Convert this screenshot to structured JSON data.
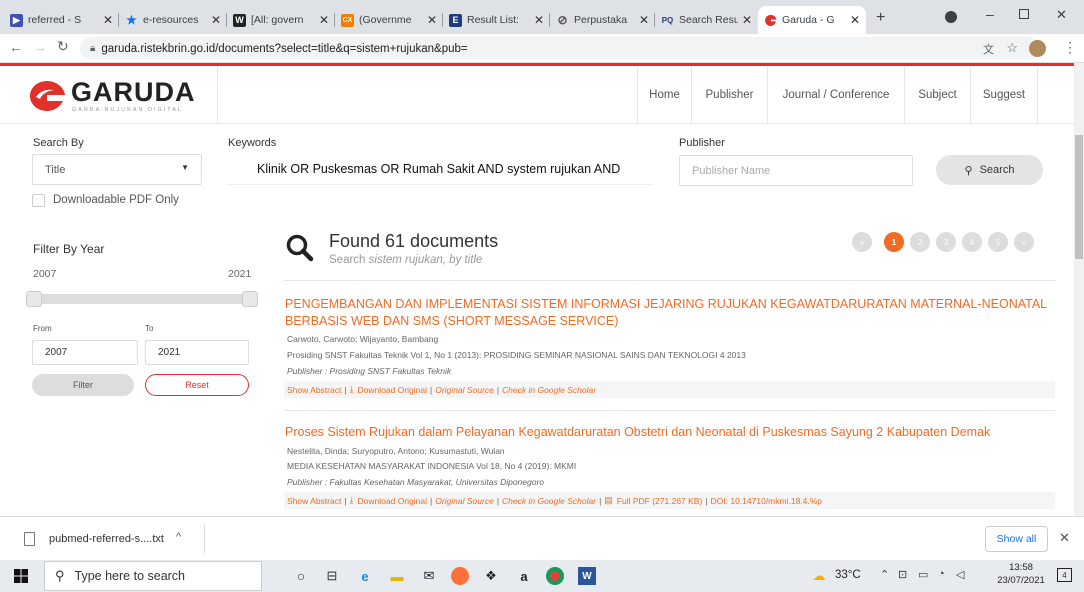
{
  "browser": {
    "tabs": [
      {
        "title": "referred - S",
        "fav_color": "#3f51b5",
        "fav": "▶"
      },
      {
        "title": "e-resources",
        "fav_color": "#1a73e8",
        "fav": "★"
      },
      {
        "title": "[All: govern",
        "fav_color": "#222222",
        "fav": "W"
      },
      {
        "title": "(Governme",
        "fav_color": "#f57c00",
        "fav": "CX"
      },
      {
        "title": "Result List:",
        "fav_color": "#1f3d7a",
        "fav": "E"
      },
      {
        "title": "Perpustaka",
        "fav_color": "#555555",
        "fav": "⊘"
      },
      {
        "title": "Search Resu",
        "fav_color": "#ffffff",
        "fav": "PQ"
      },
      {
        "title": "Garuda - G",
        "fav_color": "#e0312a",
        "fav": "G"
      }
    ],
    "url": "garuda.ristekbrin.go.id/documents?select=title&q=sistem+rujukan&pub="
  },
  "header": {
    "logo": "GARUDA",
    "logo_tagline": "GARBA RUJUKAN DIGITAL",
    "nav": [
      "Home",
      "Publisher",
      "Journal / Conference",
      "Subject",
      "Suggest"
    ]
  },
  "search": {
    "search_by_label": "Search By",
    "search_by_value": "Title",
    "keywords_label": "Keywords",
    "keywords_value": "Klinik OR Puskesmas OR Rumah Sakit AND system rujukan AND",
    "publisher_label": "Publisher",
    "publisher_placeholder": "Publisher Name",
    "search_button": "Search",
    "downloadable_label": "Downloadable PDF Only"
  },
  "filter": {
    "title": "Filter By Year",
    "min": "2007",
    "max": "2021",
    "from_label": "From",
    "to_label": "To",
    "from_value": "2007",
    "to_value": "2021",
    "filter_button": "Filter",
    "reset_button": "Reset"
  },
  "results": {
    "found": "Found 61 documents",
    "subtitle_prefix": "Search ",
    "subtitle_query": "sistem rujukan",
    "subtitle_suffix": ", by title",
    "pages": [
      "«",
      "1",
      "2",
      "3",
      "4",
      "5",
      "»"
    ],
    "current_page": "1",
    "items": [
      {
        "title": "PENGEMBANGAN DAN IMPLEMENTASI SISTEM INFORMASI JEJARING RUJUKAN KEGAWATDARURATAN MATERNAL-NEONATAL BERBASIS WEB DAN SMS (SHORT MESSAGE SERVICE)",
        "authors": "Carwoto, Carwoto; Wijayanto, Bambang",
        "source": "Prosiding SNST Fakultas Teknik Vol 1, No 1 (2013): PROSIDING SEMINAR NASIONAL SAINS DAN TEKNOLOGI 4 2013",
        "publisher_label": "Publisher : ",
        "publisher": "Prosiding SNST Fakultas Teknik",
        "show_abstract": "Show Abstract",
        "download": "Download Original",
        "original_source": "Original Source",
        "scholar": "Check in Google Scholar"
      },
      {
        "title": "Proses Sistem Rujukan dalam Pelayanan Kegawatdaruratan Obstetri dan Neonatal di Puskesmas Sayung 2 Kabupaten Demak",
        "authors": "Nestelita, Dinda; Suryoputro, Antono; Kusumastuti, Wulan",
        "source": "MEDIA KESEHATAN MASYARAKAT INDONESIA Vol 18, No 4 (2019): MKMI",
        "publisher_label": "Publisher : ",
        "publisher": "Fakultas Kesehatan Masyarakat, Universitas Diponegoro",
        "show_abstract": "Show Abstract",
        "download": "Download Original",
        "original_source": "Original Source",
        "scholar": "Check in Google Scholar",
        "full_pdf": "Full PDF (271.267 KB)",
        "doi": "DOI: 10.14710/mkmi.18.4.%p"
      }
    ]
  },
  "downloads": {
    "file": "pubmed-referred-s....txt",
    "show_all": "Show all"
  },
  "taskbar": {
    "search_placeholder": "Type here to search",
    "temperature": "33°C",
    "time": "13:58",
    "date": "23/07/2021",
    "notifications": "4"
  },
  "colors": {
    "accent": "#f06b24",
    "brand_red": "#e0312a"
  }
}
